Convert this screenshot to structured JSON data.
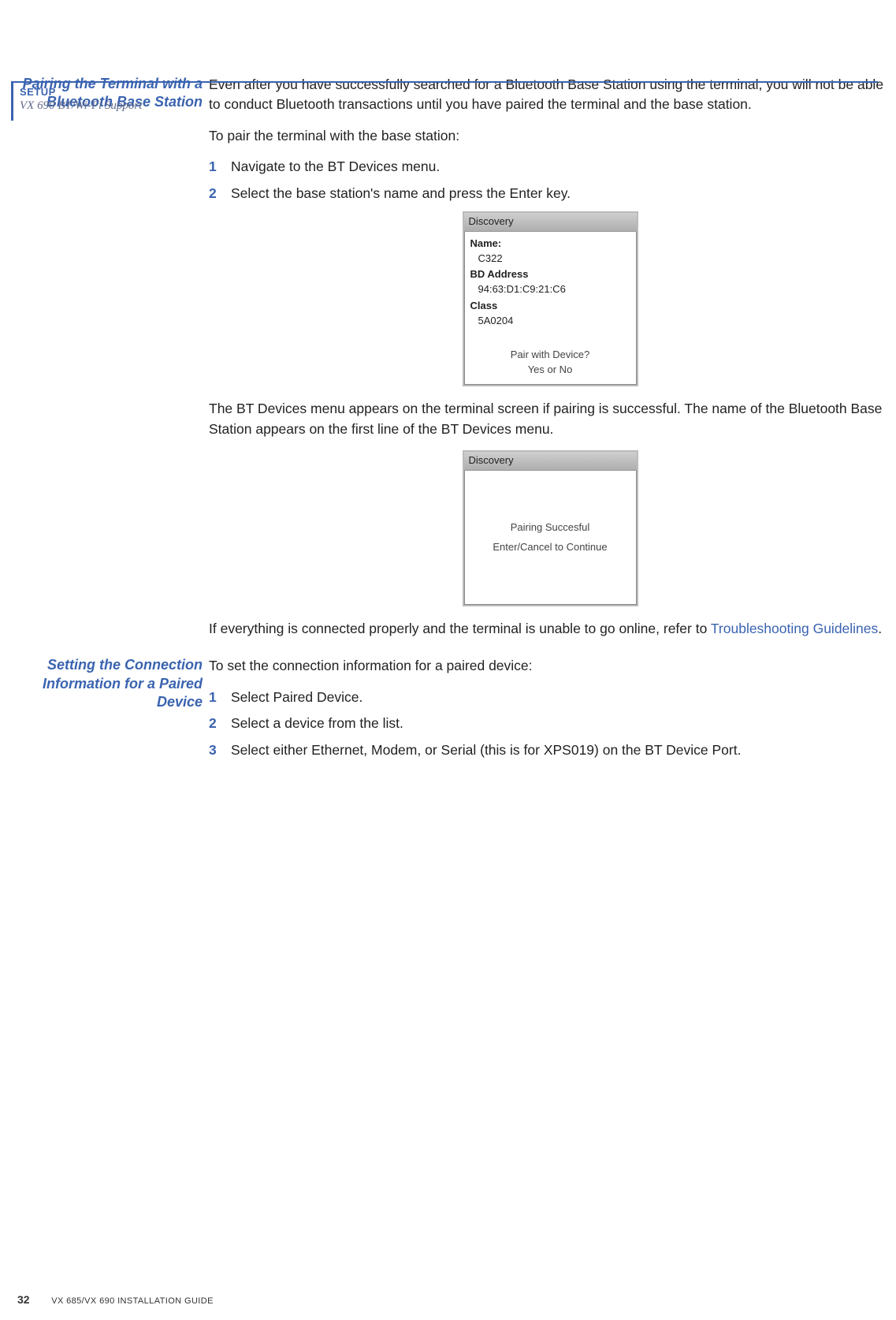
{
  "header": {
    "category": "SETUP",
    "subtitle": "VX 690 BT/Wi-Fi Support"
  },
  "section1": {
    "heading": "Pairing the Terminal with a Bluetooth Base Station",
    "intro": "Even after you have successfully searched for a Bluetooth Base Station using the terminal, you will not be able to conduct Bluetooth transactions until you have paired the terminal and the base station.",
    "lead": "To pair the terminal with the base station:",
    "steps": [
      {
        "n": "1",
        "t": "Navigate to the BT Devices menu."
      },
      {
        "n": "2",
        "t": "Select the base station's name and press the Enter key."
      }
    ],
    "shot1": {
      "title": "Discovery",
      "name_lbl": "Name:",
      "name_val": "C322",
      "addr_lbl": "BD Address",
      "addr_val": "94:63:D1:C9:21:C6",
      "class_lbl": "Class",
      "class_val": "5A0204",
      "prompt1": "Pair with Device?",
      "prompt2": "Yes or No"
    },
    "after1": "The BT Devices menu appears on the terminal screen if pairing is successful. The name of the Bluetooth Base Station appears on the first line of the BT Devices menu.",
    "shot2": {
      "title": "Discovery",
      "msg1": "Pairing Succesful",
      "msg2": "Enter/Cancel to Continue"
    },
    "trail_a": "If everything is connected properly and the terminal is unable to go online, refer to ",
    "trail_link": "Troubleshooting Guidelines",
    "trail_b": "."
  },
  "section2": {
    "heading": "Setting the Connection Information for a Paired Device",
    "lead": "To set the connection information for a paired device:",
    "steps": [
      {
        "n": "1",
        "t": "Select Paired Device."
      },
      {
        "n": "2",
        "t": "Select a device from the list."
      },
      {
        "n": "3",
        "t": "Select either Ethernet, Modem, or Serial (this is for XPS019) on the BT Device Port."
      }
    ]
  },
  "footer": {
    "page": "32",
    "guide_a": "VX 685/VX 690 I",
    "guide_b": "NSTALLATION ",
    "guide_c": "G",
    "guide_d": "UIDE"
  }
}
